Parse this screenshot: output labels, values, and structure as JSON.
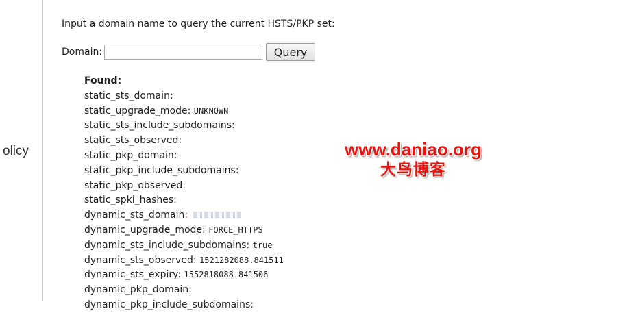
{
  "sidebar": {
    "label": "olicy"
  },
  "query_form": {
    "prompt": "Input a domain name to query the current HSTS/PKP set:",
    "domain_label": "Domain:",
    "domain_value": "",
    "button_label": "Query"
  },
  "results": {
    "title": "Found:",
    "rows": [
      {
        "key": "static_sts_domain:",
        "value": ""
      },
      {
        "key": "static_upgrade_mode:",
        "value": "UNKNOWN"
      },
      {
        "key": "static_sts_include_subdomains:",
        "value": ""
      },
      {
        "key": "static_sts_observed:",
        "value": ""
      },
      {
        "key": "static_pkp_domain:",
        "value": ""
      },
      {
        "key": "static_pkp_include_subdomains:",
        "value": ""
      },
      {
        "key": "static_pkp_observed:",
        "value": ""
      },
      {
        "key": "static_spki_hashes:",
        "value": ""
      },
      {
        "key": "dynamic_sts_domain:",
        "value": ""
      },
      {
        "key": "dynamic_upgrade_mode:",
        "value": "FORCE_HTTPS"
      },
      {
        "key": "dynamic_sts_include_subdomains:",
        "value": "true"
      },
      {
        "key": "dynamic_sts_observed:",
        "value": "1521282088.841511"
      },
      {
        "key": "dynamic_sts_expiry:",
        "value": "1552818088.841506"
      },
      {
        "key": "dynamic_pkp_domain:",
        "value": ""
      },
      {
        "key": "dynamic_pkp_include_subdomains:",
        "value": ""
      }
    ]
  },
  "watermark": {
    "url": "www.daniao.org",
    "name": "大鸟博客",
    "color": "#e8140f"
  }
}
